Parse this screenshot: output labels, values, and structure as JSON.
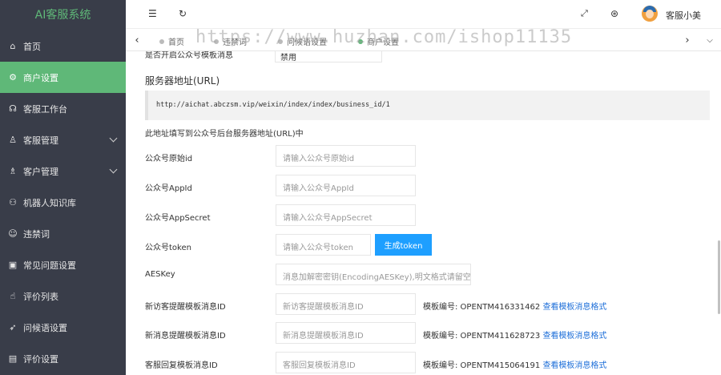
{
  "app": {
    "title": "AI客服系统"
  },
  "sidebar": {
    "items": [
      {
        "label": "首页",
        "icon": "home-icon"
      },
      {
        "label": "商户设置",
        "icon": "gear-icon",
        "active": true
      },
      {
        "label": "客服工作台",
        "icon": "headset-icon"
      },
      {
        "label": "客服管理",
        "icon": "user-icon",
        "expandable": true
      },
      {
        "label": "客户管理",
        "icon": "users-icon",
        "expandable": true
      },
      {
        "label": "机器人知识库",
        "icon": "robot-icon"
      },
      {
        "label": "违禁词",
        "icon": "ban-icon"
      },
      {
        "label": "常见问题设置",
        "icon": "question-icon"
      },
      {
        "label": "评价列表",
        "icon": "thumb-icon"
      },
      {
        "label": "问候语设置",
        "icon": "send-icon"
      },
      {
        "label": "评价设置",
        "icon": "doc-icon"
      }
    ],
    "colors": {
      "bg": "#393d49",
      "active": "#5fb878",
      "logo": "#5fb878"
    }
  },
  "topbar": {
    "user_name": "客服小美",
    "icons": [
      "menu-toggle-icon",
      "refresh-icon",
      "fullscreen-icon",
      "theme-icon"
    ]
  },
  "tabs": {
    "items": [
      {
        "label": "首页"
      },
      {
        "label": "违禁词"
      },
      {
        "label": "问候语设置"
      },
      {
        "label": "商户设置",
        "active": true
      }
    ]
  },
  "watermark": "https://www.huzhan.com/ishop11135",
  "content": {
    "partial_row": {
      "label": "是否开启公众号模板消息",
      "value": "禁用"
    },
    "server_section_title": "服务器地址(URL)",
    "server_url": "http://aichat.abczsm.vip/weixin/index/index/business_id/1",
    "server_hint": "此地址填写到公众号后台服务器地址(URL)中",
    "fields": [
      {
        "label": "公众号原始id",
        "placeholder": "请输入公众号原始id"
      },
      {
        "label": "公众号AppId",
        "placeholder": "请输入公众号AppId"
      },
      {
        "label": "公众号AppSecret",
        "placeholder": "请输入公众号AppSecret"
      },
      {
        "label": "公众号token",
        "placeholder": "请输入公众号token"
      },
      {
        "label": "AESKey",
        "placeholder": "消息加解密密钥(EncodingAESKey),明文格式请留空"
      },
      {
        "label": "新访客提醒模板消息ID",
        "placeholder": "新访客提醒模板消息ID"
      },
      {
        "label": "新消息提醒模板消息ID",
        "placeholder": "新消息提醒模板消息ID"
      },
      {
        "label": "客服回复模板消息ID",
        "placeholder": "客服回复模板消息ID"
      }
    ],
    "token_button": "生成token",
    "template_notes": [
      {
        "prefix": "模板编号: OPENTM416331462",
        "link": "查看模板消息格式"
      },
      {
        "prefix": "模板编号: OPENTM411628723",
        "link": "查看模板消息格式"
      },
      {
        "prefix": "模板编号: OPENTM415064191",
        "link": "查看模板消息格式"
      }
    ],
    "colors": {
      "primary_button": "#1e9fff",
      "link": "#1e6fd9"
    }
  }
}
